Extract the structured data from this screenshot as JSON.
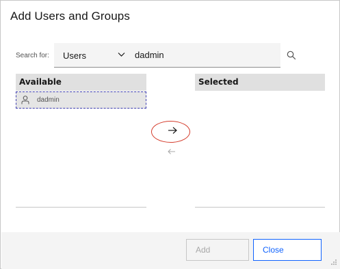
{
  "dialog": {
    "title": "Add Users and Groups"
  },
  "search": {
    "label": "Search for:",
    "type_selected": "Users",
    "value": "dadmin",
    "placeholder": ""
  },
  "available": {
    "header": "Available",
    "items": [
      {
        "label": "dadmin",
        "icon": "user-icon"
      }
    ]
  },
  "selected": {
    "header": "Selected",
    "items": []
  },
  "transfer": {
    "add_icon": "arrow-right-icon",
    "remove_icon": "arrow-left-icon"
  },
  "footer": {
    "add_label": "Add",
    "close_label": "Close"
  },
  "colors": {
    "accent": "#0f62fe",
    "highlight": "#d43a2a",
    "header_bg": "#e0e0e0",
    "field_bg": "#f4f4f4"
  }
}
